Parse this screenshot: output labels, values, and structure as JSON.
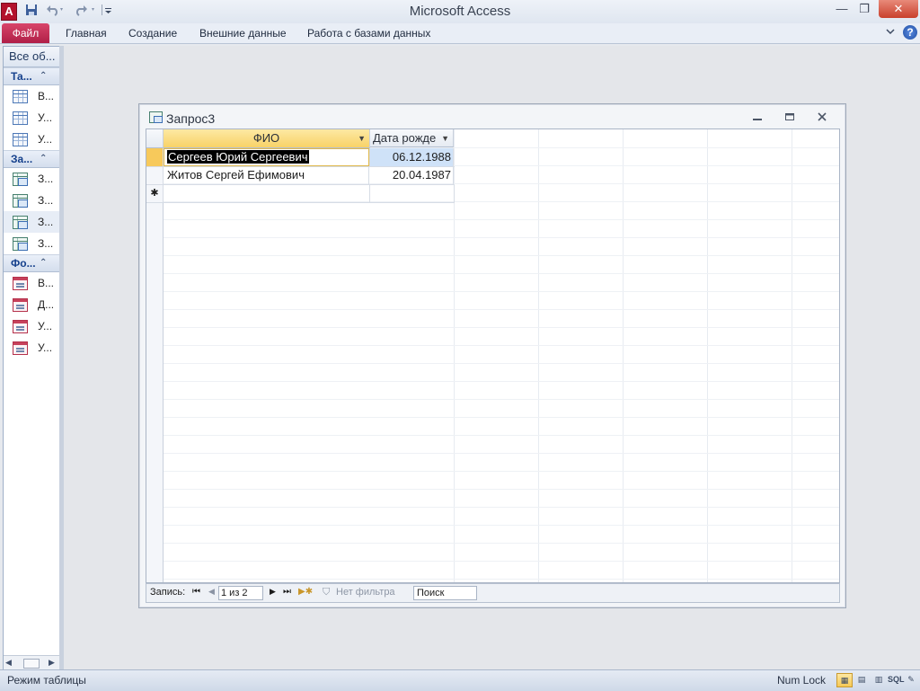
{
  "titlebar": {
    "app_icon_letter": "A",
    "title": "Microsoft Access",
    "minimize": "—",
    "restore": "❐",
    "close": "✕"
  },
  "qat": {
    "save_icon": "save-icon",
    "undo_icon": "undo-icon",
    "redo_icon": "redo-icon",
    "customize_icon": "customize-icon"
  },
  "ribbon": {
    "file": "Файл",
    "tabs": [
      "Главная",
      "Создание",
      "Внешние данные",
      "Работа с базами данных"
    ],
    "help": "?",
    "minimize_arrow": "♡"
  },
  "nav": {
    "header": "Все об...",
    "groups": [
      {
        "label": "Та...",
        "items": [
          "В...",
          "У...",
          "У..."
        ]
      },
      {
        "label": "За...",
        "items": [
          "З...",
          "З...",
          "З...",
          "З..."
        ]
      },
      {
        "label": "Фо...",
        "items": [
          "В...",
          "Д...",
          "У...",
          "У..."
        ]
      }
    ]
  },
  "query_window": {
    "title": "Запрос3",
    "columns": [
      "ФИО",
      "Дата рожде"
    ],
    "rows": [
      {
        "fio": "Сергеев Юрий Сергеевич",
        "date": "06.12.1988"
      },
      {
        "fio": "Житов Сергей Ефимович",
        "date": "20.04.1987"
      }
    ],
    "new_row_marker": "✱"
  },
  "record_nav": {
    "label": "Запись:",
    "current": "1 из 2",
    "no_filter": "Нет фильтра",
    "search": "Поиск"
  },
  "statusbar": {
    "mode": "Режим таблицы",
    "numlock": "Num Lock",
    "sql": "SQL"
  },
  "colors": {
    "file_tab": "#b01f47",
    "header_highlight": "#f8d267",
    "selected_cell": "#000000",
    "date_highlight": "#cfe2f8"
  }
}
